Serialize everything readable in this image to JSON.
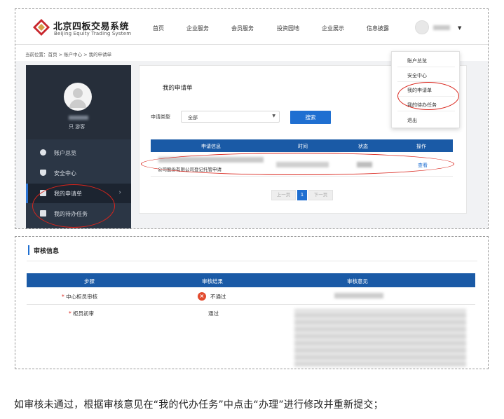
{
  "header": {
    "brand_cn": "北京四板交易系统",
    "brand_en": "Beijing Equity Trading System",
    "nav": [
      "首页",
      "企业服务",
      "会员服务",
      "投资园地",
      "企业展示",
      "信息披露"
    ],
    "user_caret": "▼"
  },
  "breadcrumb": "当前位置：首页 > 账户中心 > 我的申请单",
  "sidebar": {
    "visitor_label": "只 游客",
    "items": [
      {
        "label": "账户总览",
        "icon": "gear-icon"
      },
      {
        "label": "安全中心",
        "icon": "shield-icon"
      },
      {
        "label": "我的申请单",
        "icon": "form-icon",
        "active": true,
        "chevron": "›"
      },
      {
        "label": "我的待办任务",
        "icon": "task-icon"
      }
    ]
  },
  "main": {
    "title": "我的申请单",
    "filter_label": "申请类型",
    "select_value": "全部",
    "select_arrow": "▼",
    "search_label": "搜索",
    "columns": [
      "申请信息",
      "时间",
      "状态",
      "操作"
    ],
    "rows": [
      {
        "info": "公司股份有限公司登记托管申请",
        "action": "查看"
      }
    ],
    "pager": {
      "prev": "上一页",
      "current": "1",
      "next": "下一页"
    }
  },
  "dropdown": {
    "items": [
      "账户总览",
      "安全中心",
      "我的申请单",
      "我的待办任务",
      "退出"
    ]
  },
  "audit": {
    "title": "审核信息",
    "columns": [
      "步骤",
      "审核结果",
      "审核意见"
    ],
    "rows": [
      {
        "step": "中心柜员审核",
        "result": "不通过",
        "result_icon": "x-circle-icon"
      },
      {
        "step": "柜员初审",
        "result": "通过"
      }
    ]
  },
  "caption": "如审核未通过，根据审核意见在“我的代办任务”中点击“办理”进行修改并重新提交；",
  "colors": {
    "primary": "#1f6fd1",
    "table_header": "#1a5aa6",
    "annotation": "#d9251c",
    "sidebar": "#2b3645"
  }
}
